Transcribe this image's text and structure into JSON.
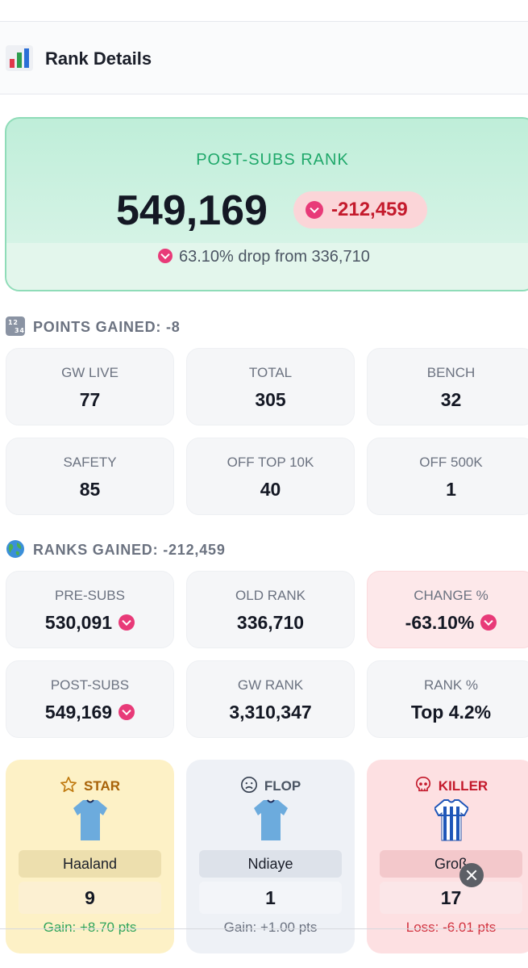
{
  "header": {
    "title": "Rank Details",
    "icon": "bar-chart-icon"
  },
  "hero": {
    "label": "POST-SUBS RANK",
    "rank": "549,169",
    "change": "-212,459",
    "drop_text": "63.10% drop from 336,710",
    "colors": {
      "accent": "#1fa86a",
      "down": "#e83a78",
      "change_text": "#c41a2c"
    }
  },
  "points": {
    "title": "POINTS GAINED: -8",
    "icon": "numbers-icon",
    "cards": [
      {
        "label": "GW LIVE",
        "value": "77"
      },
      {
        "label": "TOTAL",
        "value": "305"
      },
      {
        "label": "BENCH",
        "value": "32"
      },
      {
        "label": "SAFETY",
        "value": "85"
      },
      {
        "label": "OFF TOP 10K",
        "value": "40"
      },
      {
        "label": "OFF 500K",
        "value": "1"
      }
    ]
  },
  "ranks": {
    "title": "RANKS GAINED: -212,459",
    "icon": "globe-icon",
    "cards": [
      {
        "label": "PRE-SUBS",
        "value": "530,091"
      },
      {
        "label": "OLD RANK",
        "value": "336,710"
      },
      {
        "label": "CHANGE %",
        "value": "-63.10%"
      },
      {
        "label": "POST-SUBS",
        "value": "549,169"
      },
      {
        "label": "GW RANK",
        "value": "3,310,347"
      },
      {
        "label": "RANK %",
        "value": "Top 4.2%"
      }
    ]
  },
  "players": [
    {
      "tag": "STAR",
      "icon": "star-icon",
      "name": "Haaland",
      "points": "9",
      "gain": "Gain: +8.70 pts"
    },
    {
      "tag": "FLOP",
      "icon": "sad-face-icon",
      "name": "Ndiaye",
      "points": "1",
      "gain": "Gain: +1.00 pts"
    },
    {
      "tag": "KILLER",
      "icon": "skull-icon",
      "name": "Groß",
      "points": "17",
      "gain": "Loss: -6.01 pts"
    }
  ]
}
